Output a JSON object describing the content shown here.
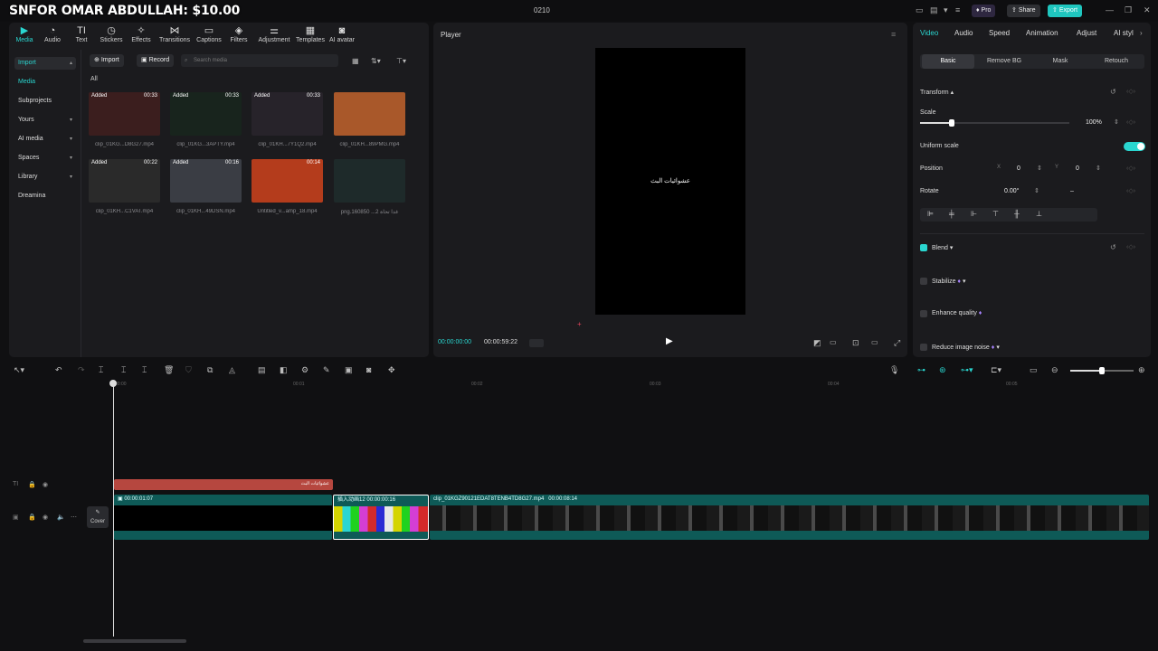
{
  "overlay_title": "SNFOR OMAR ABDULLAH: $10.00",
  "project_name": "0210",
  "topbar": {
    "pro": "Pro",
    "share": "Share",
    "export": "Export"
  },
  "media_tools": [
    "Media",
    "Audio",
    "Text",
    "Stickers",
    "Effects",
    "Transitions",
    "Captions",
    "Filters",
    "Adjustment",
    "Templates",
    "AI avatar"
  ],
  "sidebar": [
    "Import",
    "Media",
    "Subprojects",
    "Yours",
    "AI media",
    "Spaces",
    "Library",
    "Dreamina"
  ],
  "media_buttons": {
    "import": "Import",
    "record": "Record",
    "search_placeholder": "Search media"
  },
  "all_label": "All",
  "media_items": [
    {
      "tag": "Added",
      "dur": "00:33",
      "name": "clip_01KG...D8G27.mp4",
      "color": "#3b1e1e"
    },
    {
      "tag": "Added",
      "dur": "00:33",
      "name": "clip_01KG...3APTY.mp4",
      "color": "#18241d"
    },
    {
      "tag": "Added",
      "dur": "00:33",
      "name": "clip_01KH...7Y1Q2.mp4",
      "color": "#27232a"
    },
    {
      "tag": "",
      "dur": "",
      "name": "clip_01KH...89PMG.mp4",
      "color": "#a9582a"
    },
    {
      "tag": "Added",
      "dur": "00:22",
      "name": "clip_01KH...C1VAT.mp4",
      "color": "#2a2a2a"
    },
    {
      "tag": "Added",
      "dur": "00:16",
      "name": "clip_01KH...49DSN.mp4",
      "color": "#3a3d44"
    },
    {
      "tag": "",
      "dur": "00:14",
      "name": "Untitled_v...amp_18.mp4",
      "color": "#b43c1c"
    },
    {
      "tag": "",
      "dur": "",
      "name": "png.160850 ...غدا تحاة 2",
      "color": "#1e2a2a"
    }
  ],
  "player": {
    "title": "Player",
    "overlay_text": "عشوائيات البث",
    "time_current": "00:00:00:00",
    "time_total": "00:00:59:22"
  },
  "props_tabs": [
    "Video",
    "Audio",
    "Speed",
    "Animation",
    "Adjust",
    "AI styl"
  ],
  "props_subtabs": [
    "Basic",
    "Remove BG",
    "Mask",
    "Retouch"
  ],
  "props": {
    "transform": "Transform",
    "scale": "Scale",
    "scale_value": "100%",
    "scale_fraction": 0.21,
    "uniform_scale": "Uniform scale",
    "position": "Position",
    "pos_x_label": "X",
    "pos_x": "0",
    "pos_y_label": "Y",
    "pos_y": "0",
    "rotate": "Rotate",
    "rotate_value": "0.00°",
    "rotate_dash": "–",
    "blend": "Blend",
    "stabilize": "Stabilize",
    "enhance": "Enhance quality",
    "reduce_noise": "Reduce image noise"
  },
  "ruler_ticks": [
    "00:00",
    "00:01",
    "00:02",
    "00:03",
    "00:04",
    "00:05"
  ],
  "timeline": {
    "text_clip": "عشوائيات البث",
    "clip1_time": "00:00:01:07",
    "clip2_name": "插入动画12",
    "clip2_time": "00:00:00:16",
    "clip3_name": "clip_01KGZ90121EDAT8TENB4TD8G27.mp4",
    "clip3_time": "00:00:08:14",
    "cover": "Cover"
  }
}
